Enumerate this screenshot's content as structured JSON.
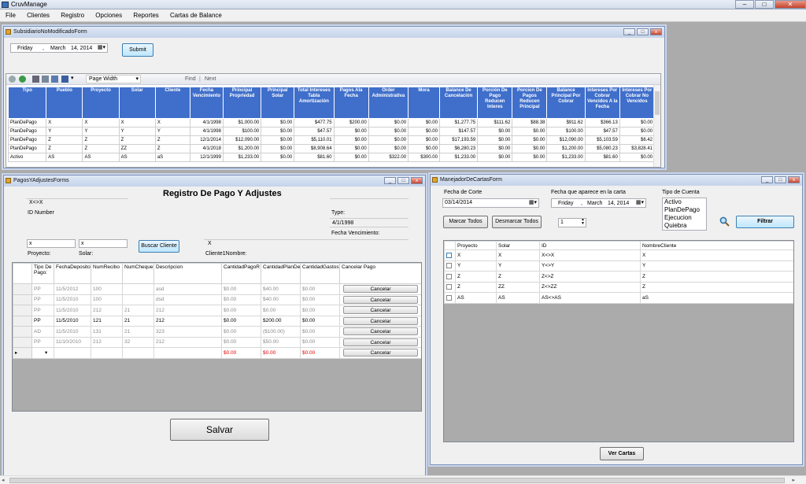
{
  "app": {
    "title": "CruvManage",
    "min": "–",
    "max": "□",
    "close": "✕"
  },
  "menu": [
    "File",
    "Clientes",
    "Registro",
    "Opciones",
    "Reportes",
    "Cartas de Balance"
  ],
  "win_btn": {
    "min": "_",
    "max": "□",
    "close": "x"
  },
  "subsidiario": {
    "title": "SubsidiarioNoModificadoForm",
    "date": {
      "day": "Friday",
      "sep": ",",
      "month": "March",
      "daynum": "14, 2014"
    },
    "submit": "Submit",
    "toolbar": {
      "zoom": "Page Width",
      "find": "Find",
      "next": "Next",
      "sep": "|"
    },
    "columns": [
      "Tipo",
      "Pueblo",
      "Proyecto",
      "Solar",
      "Cliente",
      "Fecha Vencimiento",
      "Principal Propriedad",
      "Principal Solar",
      "Total Intereses Tabla Amortización",
      "Pagos Ala Fecha",
      "Order Administrativa",
      "Mora",
      "Balance De Cancelación",
      "Porción De Pago Reducen Interes",
      "Porcion De Pagos Reducen Principal",
      "Balance Principal Por Cobrar",
      "Intereses Por Cobrar Vencidos A la Fecha",
      "Intereses Por Cobrar No Vencidos"
    ],
    "rows": [
      [
        "PlanDePago",
        "X",
        "X",
        "X",
        "X",
        "4/1/1998",
        "$1,000.00",
        "$0.00",
        "$477.75",
        "$200.00",
        "$0.00",
        "$0.00",
        "$1,277.75",
        "$111.62",
        "$88.38",
        "$911.62",
        "$366.13",
        "$0.00"
      ],
      [
        "PlanDePago",
        "Y",
        "Y",
        "Y",
        "Y",
        "4/1/1998",
        "$100.00",
        "$0.00",
        "$47.57",
        "$0.00",
        "$0.00",
        "$0.00",
        "$147.57",
        "$0.00",
        "$0.00",
        "$100.00",
        "$47.57",
        "$0.00"
      ],
      [
        "PlanDePago",
        "Z",
        "Z",
        "Z",
        "Z",
        "12/1/2014",
        "$12,090.00",
        "$0.00",
        "$5,110.01",
        "$0.00",
        "$0.00",
        "$0.00",
        "$17,193.59",
        "$0.00",
        "$0.00",
        "$12,090.00",
        "$5,103.59",
        "$6.42"
      ],
      [
        "PlanDePago",
        "Z",
        "Z",
        "ZZ",
        "Z",
        "4/1/2018",
        "$1,200.00",
        "$0.00",
        "$8,908.64",
        "$0.00",
        "$0.00",
        "$0.00",
        "$6,280.23",
        "$0.00",
        "$0.00",
        "$1,200.00",
        "$5,080.23",
        "$3,828.41"
      ],
      [
        "Activo",
        "AS",
        "AS",
        "AS",
        "aS",
        "12/1/1999",
        "$1,233.00",
        "$0.00",
        "$81.60",
        "$0.00",
        "$322.00",
        "$300.00",
        "$1,233.00",
        "$0.00",
        "$0.00",
        "$1,233.00",
        "$81.60",
        "$0.00"
      ]
    ]
  },
  "pagos": {
    "title": "PagosYAdjustesForms",
    "heading": "Registro De Pago Y Adjustes",
    "client_code": "X<>X",
    "id_label": "ID Number",
    "type_label": "Type:",
    "fecha_value": "4/1/1998",
    "fecha_label": "Fecha Vencimiento:",
    "proyecto_value": "x",
    "solar_value": "x",
    "proyecto_label": "Proyecto:",
    "solar_label": "Solar:",
    "buscar": "Buscar Cliente",
    "cliente_value": "X",
    "cliente_label": "Cliente1Nombre:",
    "columns": [
      "Tipo De Pago:",
      "FechaDeposito",
      "NumRecibo",
      "NumCheque",
      "Descripcion",
      "CantidadPagoR",
      "CantidadPlanDe",
      "CantidadGastos",
      "Cancelar Pago"
    ],
    "rows": [
      [
        "PP",
        "11/5/2012",
        "100",
        "",
        "asd",
        "$0.00",
        "$40.00",
        "$0.00",
        "Cancelar"
      ],
      [
        "PP",
        "11/5/2010",
        "100",
        "",
        "dsd",
        "$0.00",
        "$40.00",
        "$0.00",
        "Cancelar"
      ],
      [
        "PP",
        "11/5/2010",
        "212",
        "21",
        "212",
        "$0.00",
        "$0.00",
        "$0.00",
        "Cancelar"
      ],
      [
        "PP",
        "11/5/2010",
        "121",
        "21",
        "212",
        "$0.00",
        "$200.00",
        "$0.00",
        "Cancelar"
      ],
      [
        "AD",
        "11/5/2010",
        "131",
        "21",
        "323",
        "$0.00",
        "($100.00)",
        "$0.00",
        "Cancelar"
      ],
      [
        "PP",
        "11/10/2010",
        "212",
        "32",
        "212",
        "$0.00",
        "$50.00",
        "$0.00",
        "Cancelar"
      ]
    ],
    "new_row": [
      "",
      "",
      "",
      "",
      "",
      "$0.00",
      "$0.00",
      "$0.00",
      "Cancelar"
    ],
    "salvar": "Salvar"
  },
  "manejador": {
    "title": "ManejadorDeCartasForm",
    "fecha_corte_label": "Fecha de Corte",
    "fecha_corte_value": "03/14/2014",
    "fecha_carta_label": "Fecha que aparece en la carta",
    "fecha_carta": {
      "day": "Friday",
      "sep": ",",
      "month": "March",
      "daynum": "14, 2014"
    },
    "tipo_label": "Tipo de Cuenta",
    "tipos": [
      "Activo",
      "PlanDePago",
      "Ejecucion",
      "Quiebra"
    ],
    "marcar": "Marcar Todos",
    "desmarcar": "Desmarcar Todos",
    "spinner": "1",
    "filtrar": "Filtrar",
    "columns": [
      "Proyecto",
      "Solar",
      "ID",
      "NombreCliente"
    ],
    "rows": [
      [
        "X",
        "X",
        "X<>X",
        "X"
      ],
      [
        "Y",
        "Y",
        "Y<>Y",
        "Y"
      ],
      [
        "Z",
        "Z",
        "Z<>Z",
        "Z"
      ],
      [
        "Z",
        "ZZ",
        "Z<>ZZ",
        "Z"
      ],
      [
        "AS",
        "AS",
        "AS<>AS",
        "aS"
      ]
    ],
    "ver": "Ver Cartas"
  }
}
